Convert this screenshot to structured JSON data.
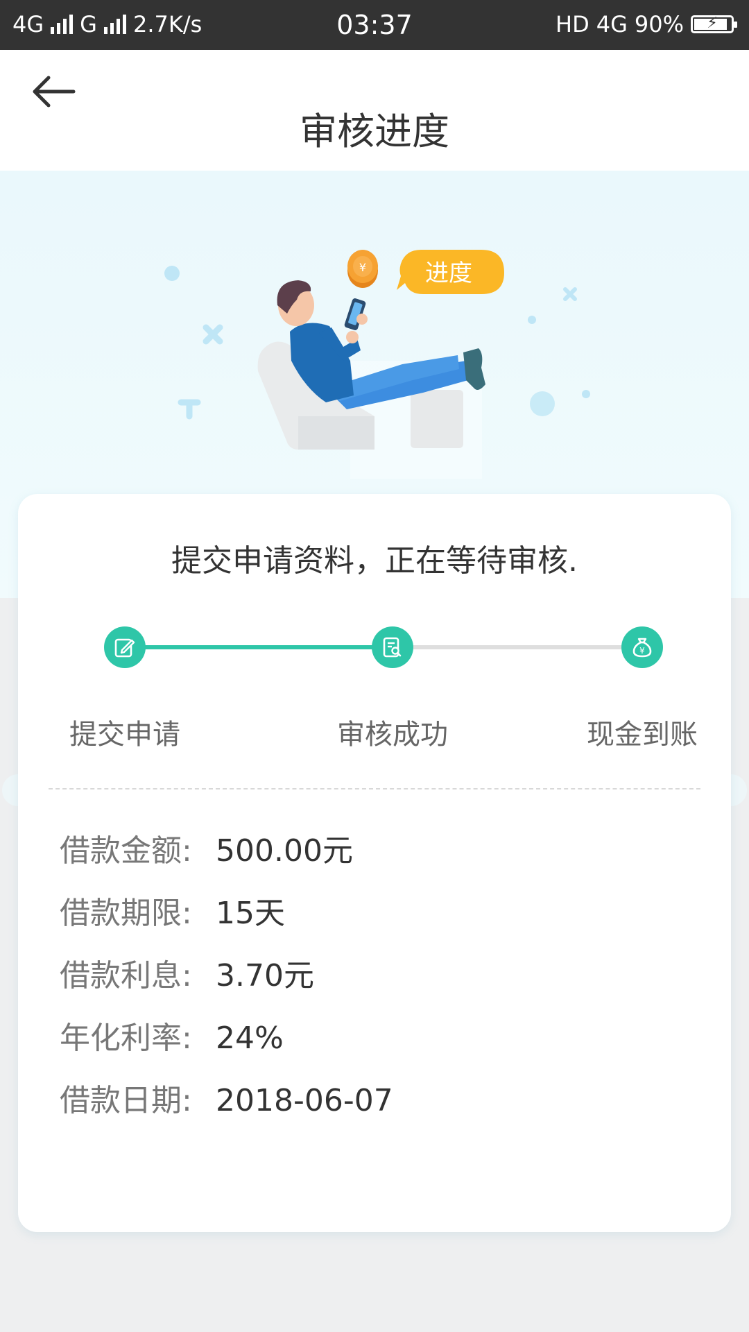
{
  "status_bar": {
    "network1": "4G",
    "network2": "G",
    "speed": "2.7K/s",
    "time": "03:37",
    "hd": "HD",
    "network3": "4G",
    "battery": "90%",
    "battery_level": 0.9
  },
  "header": {
    "title": "审核进度",
    "back_icon": "arrow-left-icon"
  },
  "hero": {
    "bubble_text": "进度"
  },
  "card": {
    "status_message": "提交申请资料，正在等待审核.",
    "steps": [
      {
        "label": "提交申请",
        "icon": "edit-icon"
      },
      {
        "label": "审核成功",
        "icon": "document-search-icon"
      },
      {
        "label": "现金到账",
        "icon": "money-bag-icon"
      }
    ],
    "progress_completed_steps": 2,
    "details": [
      {
        "label": "借款金额:",
        "value": "500.00元"
      },
      {
        "label": "借款期限:",
        "value": "15天"
      },
      {
        "label": "借款利息:",
        "value": "3.70元"
      },
      {
        "label": "年化利率:",
        "value": "24%"
      },
      {
        "label": "借款日期:",
        "value": "2018-06-07"
      }
    ]
  },
  "colors": {
    "accent": "#2ec6a8",
    "bubble": "#fbb726",
    "status_bar_bg": "#333333"
  }
}
